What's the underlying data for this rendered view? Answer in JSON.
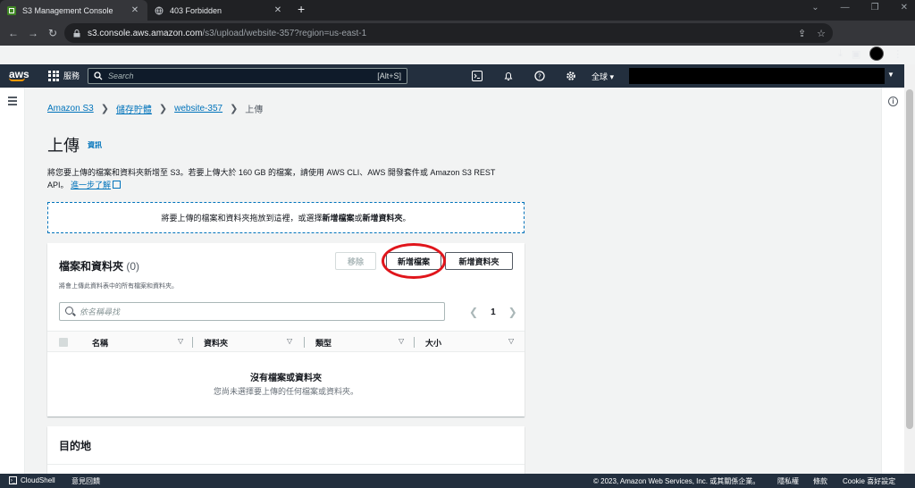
{
  "browser": {
    "tabs": [
      {
        "title": "S3 Management Console",
        "close": "✕"
      },
      {
        "title": "403 Forbidden",
        "close": "✕"
      }
    ],
    "new_tab": "+",
    "url_host": "s3.console.aws.amazon.com",
    "url_path": "/s3/upload/website-357?region=us-east-1"
  },
  "awsnav": {
    "logo": "aws",
    "services_label": "服務",
    "search_placeholder": "Search",
    "search_shortcut": "[Alt+S]",
    "region_label": "全球 ▾"
  },
  "breadcrumb": {
    "items": [
      "Amazon S3",
      "儲存貯體",
      "website-357"
    ],
    "current": "上傳",
    "separator": ">"
  },
  "page": {
    "title": "上傳",
    "info_link": "資訊",
    "description": "將您要上傳的檔案和資料夾新增至 S3。若要上傳大於 160 GB 的檔案，請使用 AWS CLI、AWS 開發套件或 Amazon S3 REST API。",
    "learn_more": "進一步了解"
  },
  "dropzone": {
    "prefix": "將要上傳的檔案和資料夾拖放到這裡，或選擇",
    "add_files": "新增檔案",
    "or": "或",
    "add_folder": "新增資料夾",
    "suffix": "。"
  },
  "files_panel": {
    "title": "檔案和資料夾",
    "count": "(0)",
    "subtitle": "將會上傳此資料表中的所有檔案和資料夾。",
    "remove_button": "移除",
    "add_files_button": "新增檔案",
    "add_folder_button": "新增資料夾",
    "filter_placeholder": "依名稱尋找",
    "page_number": "1",
    "columns": [
      "名稱",
      "資料夾",
      "類型",
      "大小"
    ],
    "empty_title": "沒有檔案或資料夾",
    "empty_subtitle": "您尚未選擇要上傳的任何檔案或資料夾。"
  },
  "destination_panel": {
    "title": "目的地"
  },
  "footer": {
    "cloudshell": "CloudShell",
    "feedback": "意見回饋",
    "copyright": "© 2023, Amazon Web Services, Inc. 或其關係企業。",
    "privacy": "隱私權",
    "terms": "條款",
    "cookie": "Cookie 喜好設定"
  },
  "colors": {
    "aws_nav": "#232f3e",
    "link": "#0073bb",
    "highlight_circle": "#e0151b"
  }
}
